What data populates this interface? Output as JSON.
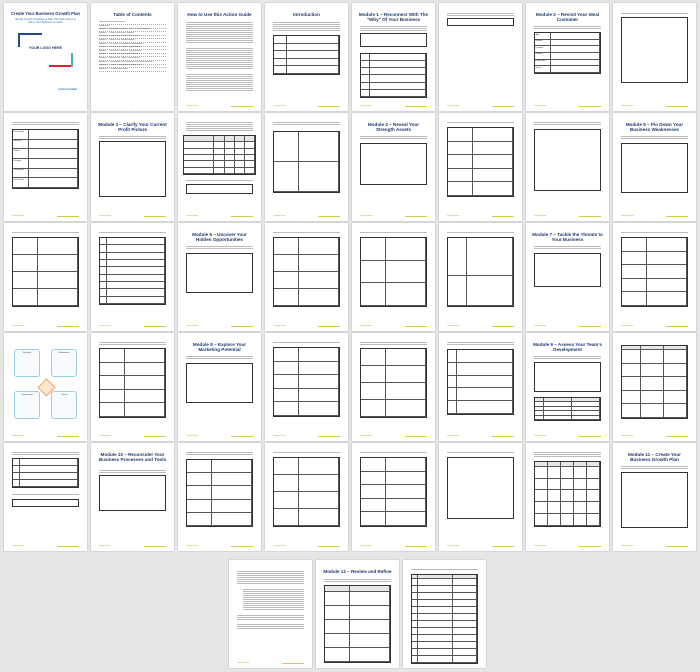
{
  "cover": {
    "title": "Create Your Business Growth Plan",
    "subtitle": "Identify Growth Obstacles & Map Out Action Steps to Move Your Business Forward",
    "logo": "YOUR LOGO HERE",
    "footer": "Action Guide"
  },
  "toc": {
    "title": "Table of Contents",
    "items": [
      "How to Use this Action Guide",
      "Introduction",
      "Module 1 – Reconnect With The \"Why\" Of Your Business",
      "Module 2 – Revisit Your Ideal Customer",
      "Module 3 – Clarify Your Current Profit Picture",
      "Module 4 – Reveal Your Strength Assets",
      "Module 5 – Pin Down Your Business Weaknesses",
      "Module 6 – Uncover Your Hidden Opportunities",
      "Module 7 – Tackle the Threats to Your Business",
      "Module 8 – Explore Your Marketing Potential",
      "Module 9 – Assess Your Team's Development",
      "Module 10 – Reconsider Your Business Processes and Tools",
      "Module 11 – Create Your Business Growth Plan",
      "Module 12 – Review and Refine"
    ]
  },
  "titles": {
    "how_to": "How to Use this Action Guide",
    "intro": "Introduction",
    "m1": "Module 1 – Reconnect With The \"Why\" Of Your Business",
    "m2": "Module 2 – Revisit Your Ideal Customer",
    "m3": "Module 3 – Clarify Your Current Profit Picture",
    "m4": "Module 4 – Reveal Your Strength Assets",
    "m5": "Module 5 – Pin Down Your Business Weaknesses",
    "m6": "Module 6 – Uncover Your Hidden Opportunities",
    "m7": "Module 7 – Tackle the Threats to Your Business",
    "m8": "Module 8 – Explore Your Marketing Potential",
    "m9": "Module 9 – Assess Your Team's Development",
    "m10": "Module 10 – Reconsider Your Business Processes and Tools",
    "m11": "Module 11 – Create Your Business Growth Plan",
    "m12": "Module 12 – Review and Refine"
  },
  "header_text": "CREATE YOUR BUSINESS GROWTH PLAN · ACTION GUIDE",
  "footer_brand": "Company Name",
  "customer_rows": [
    "Age",
    "Gender",
    "Location",
    "Income",
    "Profession",
    "Goals"
  ],
  "profile_rows": [
    "Personality",
    "Interests",
    "Values",
    "Lifestyle",
    "Challenges",
    "Pain Points"
  ],
  "swot_labels": [
    "Strengths",
    "Weaknesses",
    "Opportunities",
    "Threats"
  ],
  "colors": {
    "accent": "#1e3a6e",
    "footer": "#d8c94a",
    "page_bg": "#e6e6e6"
  }
}
